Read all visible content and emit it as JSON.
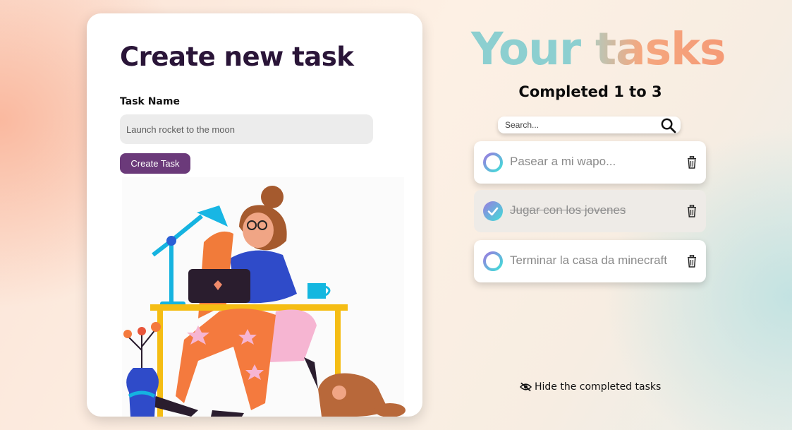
{
  "form": {
    "title": "Create new task",
    "task_name_label": "Task Name",
    "task_name_placeholder": "Launch rocket to the moon",
    "create_button_label": "Create Task"
  },
  "header": {
    "title_word1": "Your",
    "title_word2": "tasks",
    "counter_text": "Completed 1 to 3"
  },
  "search": {
    "placeholder": "Search...",
    "icon": "search-icon"
  },
  "tasks": [
    {
      "text": "Pasear a mi wapo...",
      "completed": false
    },
    {
      "text": "Jugar con los jovenes",
      "completed": true
    },
    {
      "text": "Terminar la casa da minecraft",
      "completed": false
    }
  ],
  "footer": {
    "hide_completed_label": "Hide the completed tasks",
    "icon": "eye-slash-icon"
  },
  "colors": {
    "accent": "#6b3a7a",
    "title_dark": "#2a1538",
    "title_teal": "#8ccfd0",
    "title_peach": "#f59a76"
  }
}
